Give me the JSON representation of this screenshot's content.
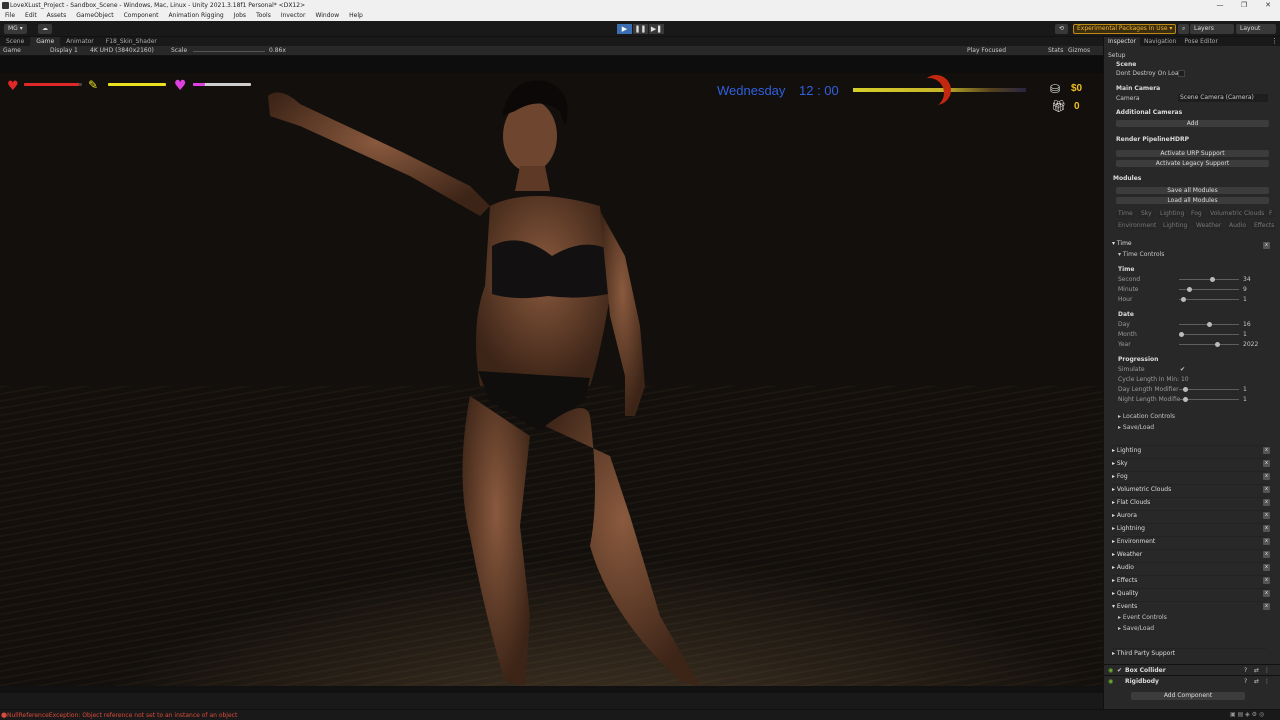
{
  "window": {
    "title": "LoveXLust_Project - Sandbox_Scene - Windows, Mac, Linux - Unity 2021.3.18f1 Personal* <DX12>",
    "controls": [
      "—",
      "❐",
      "✕"
    ]
  },
  "menu": [
    "File",
    "Edit",
    "Assets",
    "GameObject",
    "Component",
    "Animation Rigging",
    "Jobs",
    "Tools",
    "Invector",
    "Window",
    "Help"
  ],
  "toolbar": {
    "account": "MG ▾",
    "cloud": "☁",
    "experimental": "Experimental Packages In Use ▾",
    "layers": "Layers",
    "layout": "Layout",
    "history": "⟲",
    "search": "⌕"
  },
  "play": {
    "play": "▶",
    "pause": "❚❚",
    "step": "▶❚"
  },
  "tabs": [
    "Scene",
    "Game",
    "Animator",
    "F18_Skin_Shader"
  ],
  "game_controls": {
    "mode": "Game",
    "display": "Display 1",
    "resolution": "4K UHD (3840x2160)",
    "scale_label": "Scale",
    "scale_value": "0.86x",
    "play_focused": "Play Focused",
    "stats": "Stats",
    "gizmos": "Gizmos"
  },
  "hud": {
    "health_fraction": 0.95,
    "energy_fraction": 1.0,
    "love_fraction": 0.2,
    "day": "Wednesday",
    "time": "12 : 00",
    "daybar_fraction": 0.55,
    "money": "$0",
    "gifts": "0",
    "colors": {
      "health": "#e02828",
      "energy": "#e8e020",
      "love": "#e040e0",
      "text": "#3060e0",
      "currency": "#f0c020"
    }
  },
  "inspector": {
    "tabs": [
      "Inspector",
      "Navigation",
      "Pose Editor"
    ],
    "setup": "Setup",
    "scene_header": "Scene",
    "dont_destroy": "Dont Destroy On Loa",
    "main_camera_header": "Main Camera",
    "camera_label": "Camera",
    "camera_value": "Scene Camera (Camera)",
    "additional_cameras": "Additional Cameras",
    "add": "Add",
    "render_pipeline_label": "Render Pipeline:",
    "render_pipeline_value": "HDRP",
    "activate_urp": "Activate URP Support",
    "activate_legacy": "Activate Legacy Support",
    "modules": "Modules",
    "save_modules": "Save all Modules",
    "load_modules": "Load all Modules",
    "module_chips_row1": [
      "Time",
      "Sky",
      "Lighting",
      "Fog",
      "Volumetric Clouds",
      "F"
    ],
    "module_chips_row2": [
      "Environment",
      "Lighting",
      "Weather",
      "Audio",
      "Effects"
    ],
    "time_header": "Time",
    "time_controls": "Time Controls",
    "time_sub": "Time",
    "second": {
      "label": "Second",
      "value": "34",
      "fraction": 0.57
    },
    "minute": {
      "label": "Minute",
      "value": "9",
      "fraction": 0.15
    },
    "hour": {
      "label": "Hour",
      "value": "1",
      "fraction": 0.04
    },
    "date_sub": "Date",
    "day": {
      "label": "Day",
      "value": "16",
      "fraction": 0.5
    },
    "month": {
      "label": "Month",
      "value": "1",
      "fraction": 0.0
    },
    "year": {
      "label": "Year",
      "value": "2022",
      "fraction": 0.65
    },
    "progression": "Progression",
    "simulate": "Simulate",
    "simulate_check": "✔",
    "cycle_length": "Cycle Length In Min: 10",
    "day_mod": {
      "label": "Day Length Modifier",
      "value": "1"
    },
    "night_mod": {
      "label": "Night Length Modifie",
      "value": "1"
    },
    "location_controls": "Location Controls",
    "save_load": "Save/Load",
    "sections": [
      "Lighting",
      "Sky",
      "Fog",
      "Volumetric Clouds",
      "Flat Clouds",
      "Aurora",
      "Lightning",
      "Environment",
      "Weather",
      "Audio",
      "Effects",
      "Quality",
      "Events"
    ],
    "event_controls": "Event Controls",
    "save_load2": "Save/Load",
    "third_party": "Third Party Support",
    "box_collider": "Box Collider",
    "rigidbody": "Rigidbody",
    "add_component": "Add Component"
  },
  "status": {
    "error": "NullReferenceException: Object reference not set to an instance of an object"
  }
}
